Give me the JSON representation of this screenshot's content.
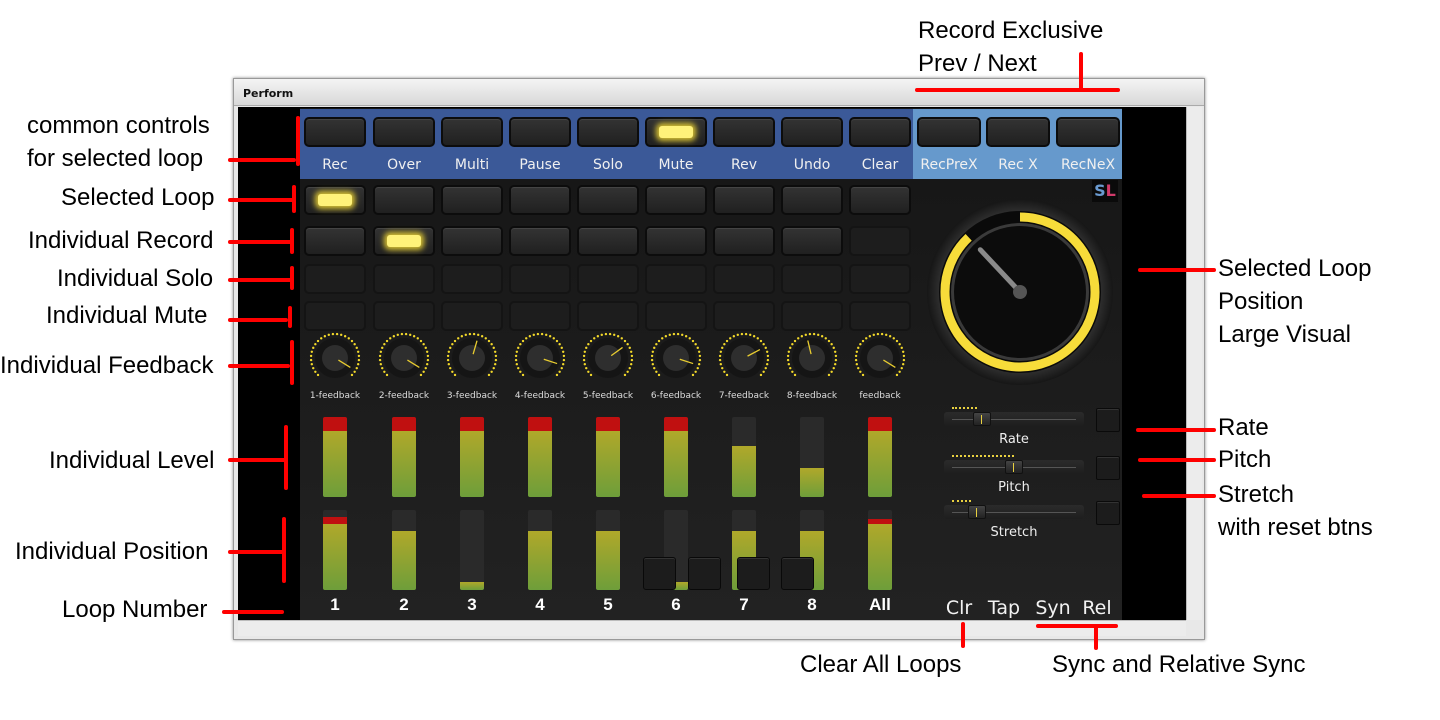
{
  "window": {
    "title": "Perform"
  },
  "transport": {
    "buttons": [
      {
        "label": "Rec",
        "lit": false
      },
      {
        "label": "Over",
        "lit": false
      },
      {
        "label": "Multi",
        "lit": false
      },
      {
        "label": "Pause",
        "lit": false
      },
      {
        "label": "Solo",
        "lit": false
      },
      {
        "label": "Mute",
        "lit": true
      },
      {
        "label": "Rev",
        "lit": false
      },
      {
        "label": "Undo",
        "lit": false
      },
      {
        "label": "Clear",
        "lit": false
      }
    ],
    "exclusive": [
      {
        "label": "RecPreX"
      },
      {
        "label": "Rec X"
      },
      {
        "label": "RecNeX"
      }
    ],
    "colors": {
      "common": "#3b5998",
      "exclusive": "#6699cc"
    }
  },
  "loops": [
    {
      "number": "1",
      "selected": true,
      "record": false,
      "feedback_label": "1-feedback",
      "feedback": 0.95,
      "level": 1.0,
      "position": 0.91
    },
    {
      "number": "2",
      "selected": false,
      "record": true,
      "feedback_label": "2-feedback",
      "feedback": 0.95,
      "level": 1.0,
      "position": 0.74
    },
    {
      "number": "3",
      "selected": false,
      "record": false,
      "feedback_label": "3-feedback",
      "feedback": 0.56,
      "level": 1.0,
      "position": 0.1
    },
    {
      "number": "4",
      "selected": false,
      "record": false,
      "feedback_label": "4-feedback",
      "feedback": 0.9,
      "level": 1.0,
      "position": 0.74
    },
    {
      "number": "5",
      "selected": false,
      "record": false,
      "feedback_label": "5-feedback",
      "feedback": 0.7,
      "level": 1.0,
      "position": 0.74
    },
    {
      "number": "6",
      "selected": false,
      "record": false,
      "feedback_label": "6-feedback",
      "feedback": 0.9,
      "level": 1.0,
      "position": 0.1
    },
    {
      "number": "7",
      "selected": false,
      "record": false,
      "feedback_label": "7-feedback",
      "feedback": 0.73,
      "level": 0.64,
      "position": 0.74
    },
    {
      "number": "8",
      "selected": false,
      "record": false,
      "feedback_label": "8-feedback",
      "feedback": 0.45,
      "level": 0.36,
      "position": 0.74
    },
    {
      "number": "All",
      "selected": false,
      "record": null,
      "feedback_label": "feedback",
      "feedback": 0.95,
      "level": 1.0,
      "position": 0.89
    }
  ],
  "position_dial": {
    "fraction": 0.88
  },
  "sliders": [
    {
      "label": "Rate",
      "value": 0.2
    },
    {
      "label": "Pitch",
      "value": 0.5
    },
    {
      "label": "Stretch",
      "value": 0.15
    }
  ],
  "bottom_buttons": [
    {
      "label": "Clr"
    },
    {
      "label": "Tap"
    },
    {
      "label": "Syn"
    },
    {
      "label": "Rel"
    }
  ],
  "annotations": {
    "record_exclusive": [
      "Record Exclusive",
      "Prev / Next"
    ],
    "common": [
      "common controls",
      "for selected loop"
    ],
    "selected_loop": "Selected Loop",
    "individual_record": "Individual Record",
    "individual_solo": "Individual Solo",
    "individual_mute": "Individual Mute",
    "individual_feedback": "Individual Feedback",
    "individual_level": "Individual Level",
    "individual_position": "Individual Position",
    "loop_number": "Loop Number",
    "selected_position": [
      "Selected Loop",
      "Position",
      "Large Visual"
    ],
    "rate": "Rate",
    "pitch": "Pitch",
    "stretch": [
      "Stretch",
      "with reset btns"
    ],
    "clear_all": "Clear All Loops",
    "sync": "Sync and Relative Sync"
  }
}
